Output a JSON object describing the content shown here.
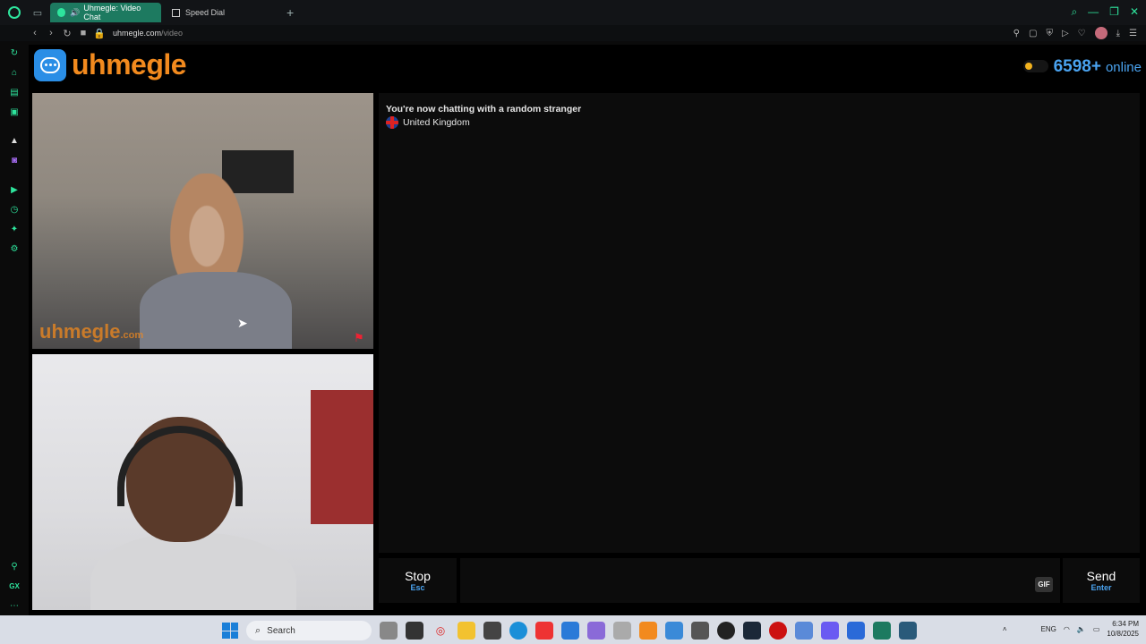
{
  "browser": {
    "tabs": [
      {
        "label": "Uhmegle: Video Chat",
        "active": true
      },
      {
        "label": "Speed Dial",
        "active": false
      }
    ],
    "url_host": "uhmegle.com",
    "url_path": "/video"
  },
  "site": {
    "logo_text": "uhmegle",
    "online_count": "6598+",
    "online_label": "online"
  },
  "stranger_video": {
    "watermark": "uhmegle",
    "watermark_suffix": ".com"
  },
  "chat": {
    "status": "You're now chatting with a random stranger",
    "country": "United Kingdom"
  },
  "controls": {
    "stop_label": "Stop",
    "stop_key": "Esc",
    "gif_label": "GIF",
    "send_label": "Send",
    "send_key": "Enter"
  },
  "taskbar": {
    "search_label": "Search",
    "lang": "ENG",
    "time": "6:34 PM",
    "date": "10/8/2025"
  },
  "colors": {
    "brand_orange": "#f28a1e",
    "accent_blue": "#4aa3f0",
    "opera_green": "#2ee59d"
  }
}
